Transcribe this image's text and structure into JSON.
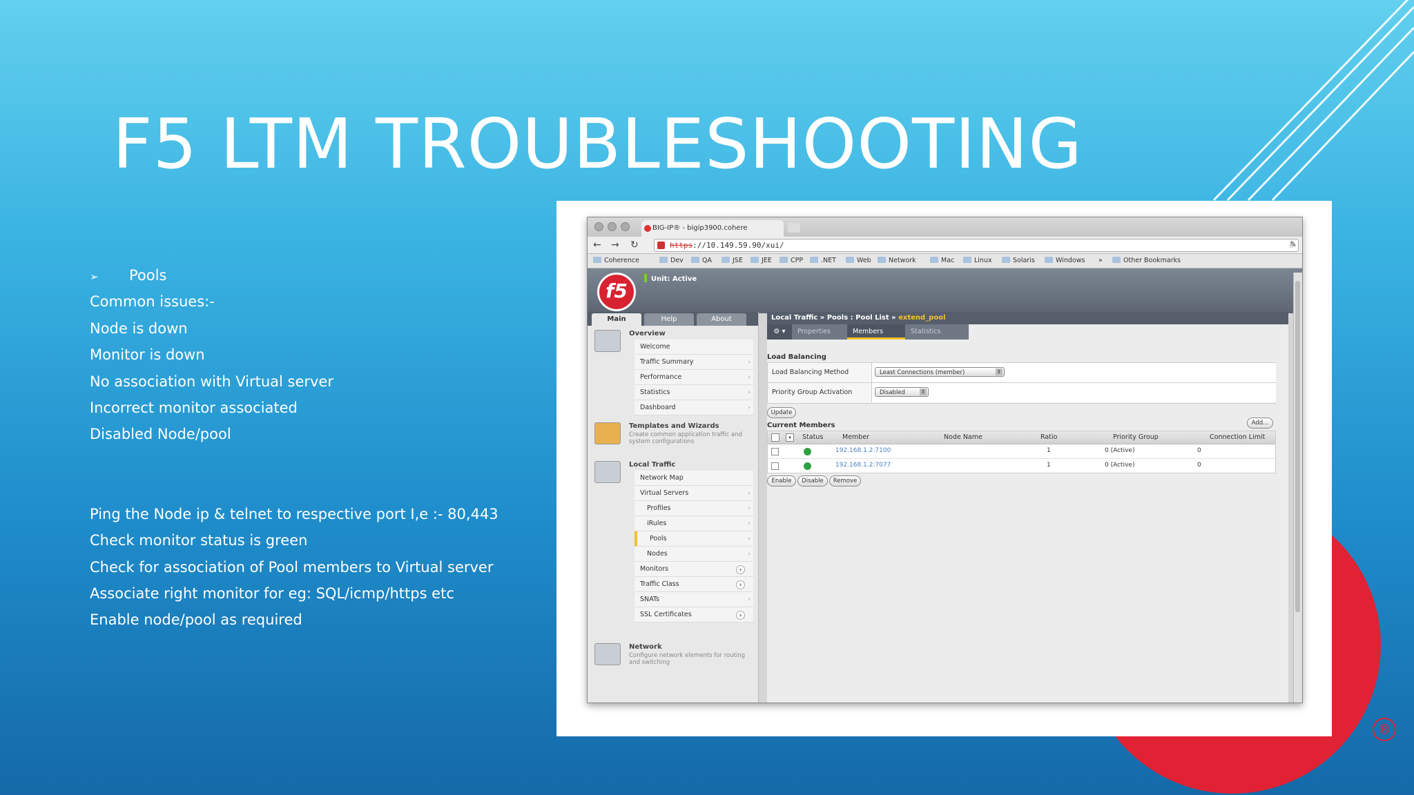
{
  "slide": {
    "title": "F5 LTM TROUBLESHOOTING",
    "bullet_head": "Pools",
    "bullet_arrow": "➢",
    "issues": [
      "Common issues:-",
      "Node is down",
      "Monitor is down",
      "No association with Virtual server",
      "Incorrect monitor associated",
      "Disabled Node/pool"
    ],
    "fixes": [
      "Ping the Node ip & telnet to respective port I,e :- 80,443",
      "Check monitor status is green",
      "Check for association of Pool members to Virtual server",
      "Associate right monitor for eg: SQL/icmp/https etc",
      "Enable node/pool as required"
    ],
    "registered": "®",
    "colors": {
      "accent": "#e02234",
      "bg_top": "#62d0ee",
      "bg_bottom": "#1569a8"
    }
  },
  "browser": {
    "tab_title": "BIG-IP® - bigip3900.cohere",
    "url_scheme": "https",
    "url_rest": "://10.149.59.90/xui/",
    "bookmarks": [
      "Coherence",
      "Dev",
      "QA",
      "JSE",
      "JEE",
      "CPP",
      ".NET",
      "Web",
      "Network",
      "Mac",
      "Linux",
      "Solaris",
      "Windows",
      "»",
      "Other Bookmarks"
    ]
  },
  "app": {
    "logo": "f5",
    "unit_status": "Unit: Active",
    "side_tabs": [
      "Main",
      "Help",
      "About"
    ],
    "overview": {
      "heading": "Overview",
      "items": [
        "Welcome",
        "Traffic Summary",
        "Performance",
        "Statistics",
        "Dashboard"
      ]
    },
    "templates": {
      "heading": "Templates and Wizards",
      "desc": "Create common application traffic and system configurations"
    },
    "local_traffic": {
      "heading": "Local Traffic",
      "items": [
        "Network Map",
        "Virtual Servers",
        "Profiles",
        "iRules",
        "Pools",
        "Nodes",
        "Monitors",
        "Traffic Class",
        "SNATs",
        "SSL Certificates"
      ]
    },
    "network": {
      "heading": "Network",
      "desc": "Configure network elements for routing and switching"
    },
    "breadcrumb": {
      "prefix": "Local Traffic  »  Pools : Pool List  »",
      "pool": "extend_pool"
    },
    "content_tabs": [
      "Properties",
      "Members",
      "Statistics"
    ],
    "load_balancing": {
      "heading": "Load Balancing",
      "method_label": "Load Balancing Method",
      "method_value": "Least Connections (member)",
      "pga_label": "Priority Group Activation",
      "pga_value": "Disabled",
      "update_label": "Update"
    },
    "members": {
      "heading": "Current Members",
      "add_label": "Add...",
      "columns": [
        "Status",
        "Member",
        "Node Name",
        "Ratio",
        "Priority Group",
        "Connection Limit"
      ],
      "rows": [
        {
          "member": "192.168.1.2:7100",
          "node": "",
          "ratio": "1",
          "priority": "0 (Active)",
          "limit": "0"
        },
        {
          "member": "192.168.1.2:7077",
          "node": "",
          "ratio": "1",
          "priority": "0 (Active)",
          "limit": "0"
        }
      ],
      "actions": [
        "Enable",
        "Disable",
        "Remove"
      ]
    }
  }
}
